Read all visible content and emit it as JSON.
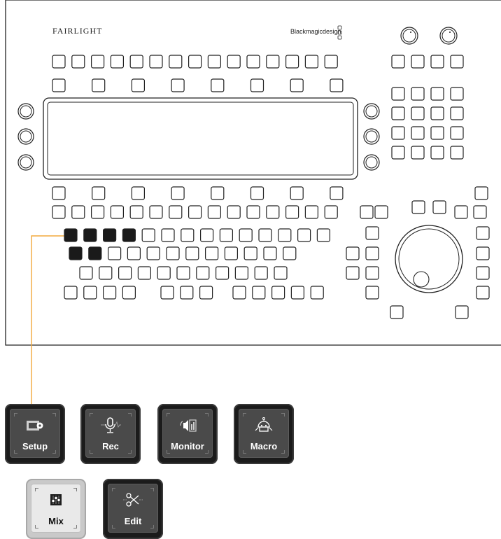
{
  "panel": {
    "brand_left": "FAIRLIGHT",
    "brand_right": "Blackmagicdesign"
  },
  "colors": {
    "callout_line": "#f2a93b",
    "highlight_key": "#1a1a1a",
    "panel_stroke": "#222222"
  },
  "function_keys": [
    {
      "label": "Setup",
      "icon": "setup-icon",
      "lit": false
    },
    {
      "label": "Rec",
      "icon": "microphone-icon",
      "lit": false
    },
    {
      "label": "Monitor",
      "icon": "monitor-speaker-icon",
      "lit": false
    },
    {
      "label": "Macro",
      "icon": "macro-robot-icon",
      "lit": false
    },
    {
      "label": "Mix",
      "icon": "mixer-icon",
      "lit": true
    },
    {
      "label": "Edit",
      "icon": "scissors-icon",
      "lit": false
    }
  ]
}
